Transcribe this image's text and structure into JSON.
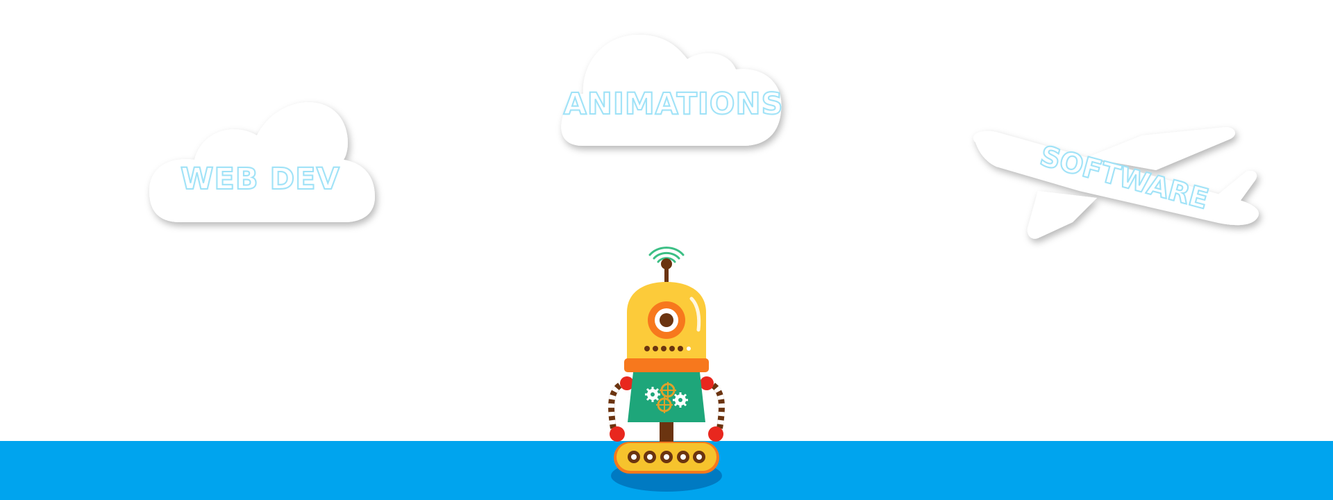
{
  "scene": {
    "clouds": [
      {
        "label": "WEB DEV",
        "icon": "cloud-icon"
      },
      {
        "label": "ANIMATIONS",
        "icon": "cloud-icon"
      }
    ],
    "plane": {
      "label": "SOFTWARE",
      "icon": "airplane-icon"
    },
    "robot": {
      "icon": "robot-icon"
    }
  },
  "colors": {
    "background": "#ffffff",
    "ground": "#00a4ee",
    "label_outline": "#9fe2f7",
    "robot_head": "#fccb3a",
    "robot_collar": "#f7781d",
    "robot_body": "#1ea67a",
    "robot_hands": "#e8271e",
    "robot_base": "#f6c32d",
    "antenna_signal": "#3cbf85"
  }
}
